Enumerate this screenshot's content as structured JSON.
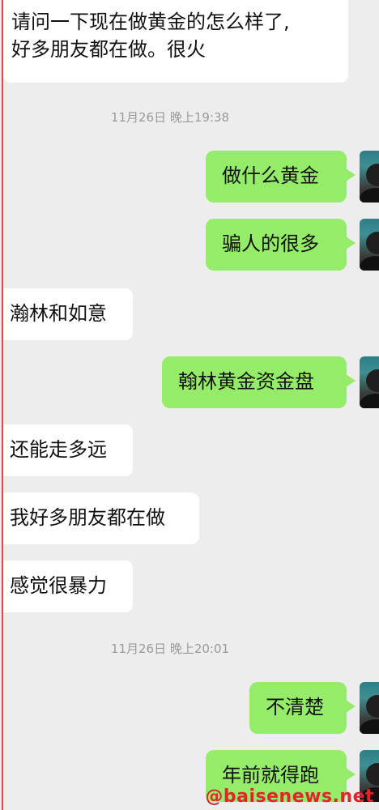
{
  "messages": [
    {
      "side": "left",
      "lines": [
        "请问一下现在做黄金的怎么样了,",
        "好多朋友都在做。很火"
      ]
    },
    {
      "side": "right",
      "text": "做什么黄金"
    },
    {
      "side": "right",
      "text": "骗人的很多"
    },
    {
      "side": "left",
      "text": "瀚林和如意"
    },
    {
      "side": "right",
      "text": "翰林黄金资金盘"
    },
    {
      "side": "left",
      "text": "还能走多远"
    },
    {
      "side": "left",
      "text": "我好多朋友都在做"
    },
    {
      "side": "left",
      "text": "感觉很暴力"
    },
    {
      "side": "right",
      "text": "不清楚"
    },
    {
      "side": "right",
      "text": "年前就得跑"
    }
  ],
  "timestamps": [
    "11月26日 晚上19:38",
    "11月26日 晚上20:01"
  ],
  "watermark": "@baisenews.net",
  "colors": {
    "background": "#ededed",
    "own_bubble": "#95ec69",
    "other_bubble": "#ffffff",
    "watermark": "#e0262c"
  },
  "avatar_icon": "teal-dark-photo-avatar"
}
